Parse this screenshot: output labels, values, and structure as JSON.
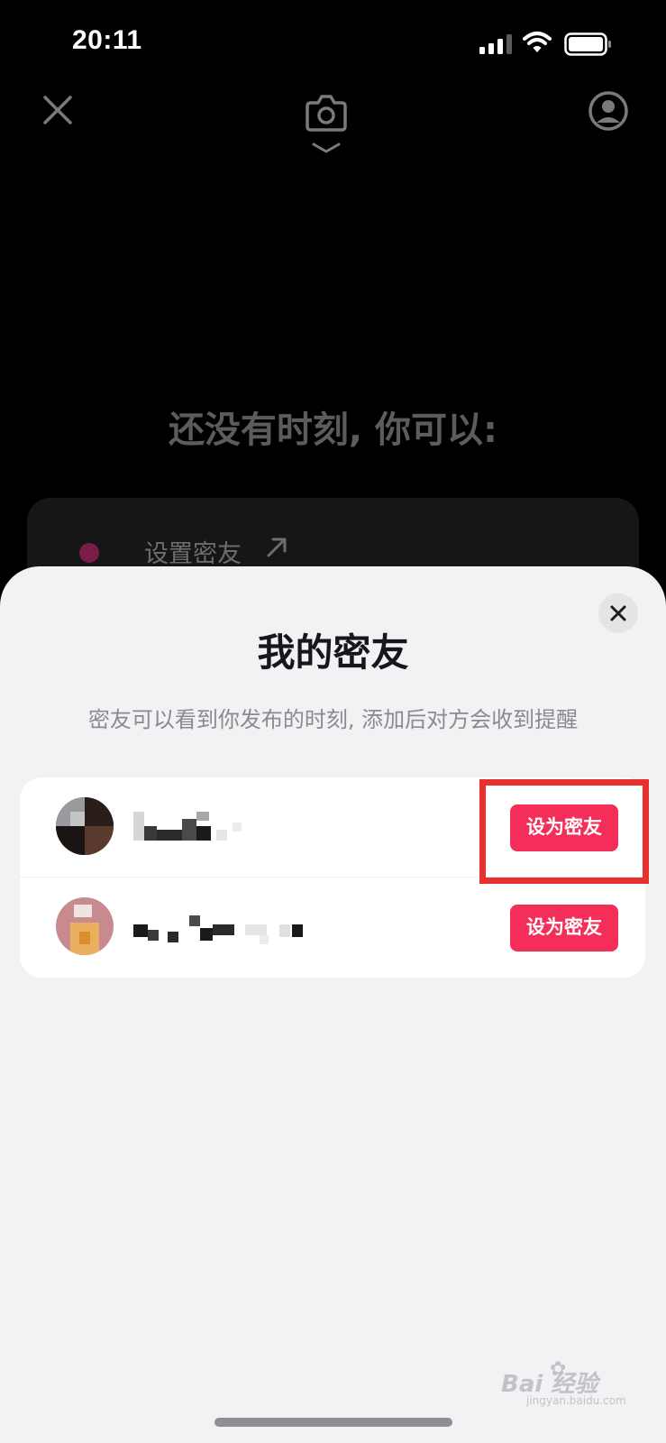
{
  "status_bar": {
    "time": "20:11"
  },
  "top_nav": {
    "close_icon": "close-icon",
    "camera_icon": "camera-icon",
    "profile_icon": "profile-icon"
  },
  "empty_state": {
    "title": "还没有时刻, 你可以:",
    "suggestion_label": "设置密友"
  },
  "sheet": {
    "title": "我的密友",
    "subtitle": "密友可以看到你发布的时刻, 添加后对方会收到提醒",
    "friends": [
      {
        "button_label": "设为密友"
      },
      {
        "button_label": "设为密友"
      }
    ]
  },
  "colors": {
    "accent": "#f42e58",
    "highlight": "#e8312c",
    "sheet_bg": "#f2f2f4"
  },
  "watermark": {
    "main": "Bai 经验",
    "sub": "jingyan.baidu.com"
  }
}
